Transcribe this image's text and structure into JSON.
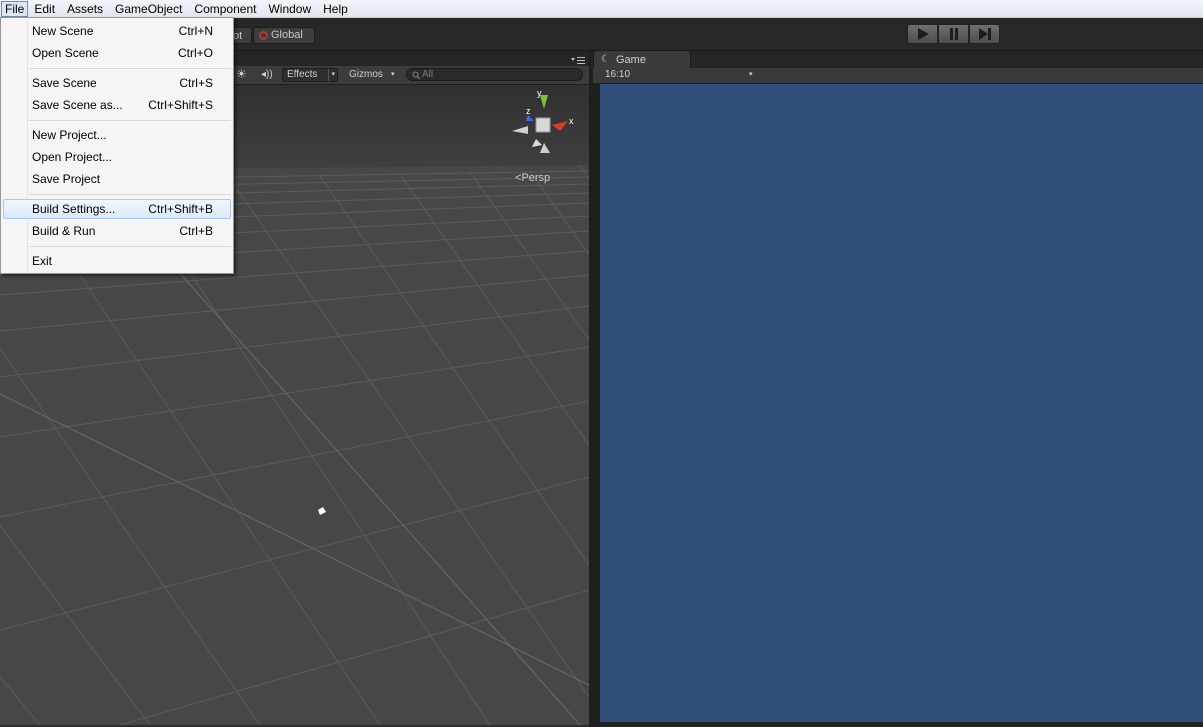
{
  "menubar": {
    "items": [
      "File",
      "Edit",
      "Assets",
      "GameObject",
      "Component",
      "Window",
      "Help"
    ]
  },
  "toolbar": {
    "pivot_partial": "ot",
    "global_label": "Global"
  },
  "scene": {
    "effects_label": "Effects",
    "gizmos_label": "Gizmos",
    "search_placeholder": "All",
    "persp_label": "Persp",
    "axis_y": "y",
    "axis_x": "x",
    "axis_z": "z"
  },
  "game": {
    "tab_label": "Game",
    "aspect": "16:10",
    "background_color": "#314d79"
  },
  "file_menu": {
    "items": [
      {
        "label": "New Scene",
        "shortcut": "Ctrl+N"
      },
      {
        "label": "Open Scene",
        "shortcut": "Ctrl+O"
      },
      {
        "label": "Save Scene",
        "shortcut": "Ctrl+S"
      },
      {
        "label": "Save Scene as...",
        "shortcut": "Ctrl+Shift+S"
      },
      {
        "label": "New Project..."
      },
      {
        "label": "Open Project..."
      },
      {
        "label": "Save Project"
      },
      {
        "label": "Build Settings...",
        "shortcut": "Ctrl+Shift+B",
        "highlighted": true
      },
      {
        "label": "Build & Run",
        "shortcut": "Ctrl+B"
      },
      {
        "label": "Exit"
      }
    ]
  }
}
